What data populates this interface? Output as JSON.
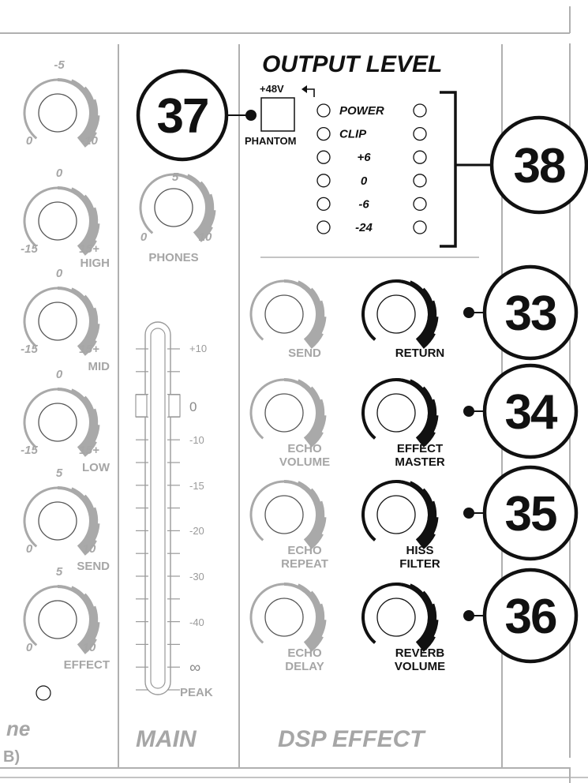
{
  "colors": {
    "ink": "#111111",
    "inactive": "#a9a9a9",
    "panel_line": "#b0b0b0",
    "background": "#ffffff"
  },
  "sections": {
    "main_title": "MAIN",
    "dsp_title": "DSP EFFECT",
    "output_level_title": "OUTPUT LEVEL",
    "left_partial_line1": "ne",
    "left_partial_line2": "B)"
  },
  "left_knobs": [
    {
      "top": "-5",
      "left": "0",
      "right": "-10",
      "label": ""
    },
    {
      "top": "0",
      "left": "-15",
      "right": "15+",
      "label": "HIGH"
    },
    {
      "top": "0",
      "left": "-15",
      "right": "15+",
      "label": "MID"
    },
    {
      "top": "0",
      "left": "-15",
      "right": "15+",
      "label": "LOW"
    },
    {
      "top": "5",
      "left": "0",
      "right": "10",
      "label": "SEND"
    },
    {
      "top": "5",
      "left": "0",
      "right": "10",
      "label": "EFFECT"
    }
  ],
  "phones_knob": {
    "top": "5",
    "left": "0",
    "right": "10",
    "label": "PHONES"
  },
  "phantom": {
    "voltage_label": "+48V",
    "button_label": "PHANTOM"
  },
  "led_labels": [
    "POWER",
    "CLIP",
    "+6",
    "0",
    "-6",
    "-24"
  ],
  "meter": {
    "labels": [
      "+10",
      "0",
      "-10",
      "-15",
      "-20",
      "-30",
      "-40",
      "∞"
    ],
    "peak_label": "PEAK"
  },
  "dsp_knobs_left": [
    {
      "line1": "SEND",
      "line2": ""
    },
    {
      "line1": "ECHO",
      "line2": "VOLUME"
    },
    {
      "line1": "ECHO",
      "line2": "REPEAT"
    },
    {
      "line1": "ECHO",
      "line2": "DELAY"
    }
  ],
  "dsp_knobs_right": [
    {
      "line1": "RETURN",
      "line2": "",
      "callout": "33"
    },
    {
      "line1": "EFFECT",
      "line2": "MASTER",
      "callout": "34"
    },
    {
      "line1": "HISS",
      "line2": "FILTER",
      "callout": "35"
    },
    {
      "line1": "REVERB",
      "line2": "VOLUME",
      "callout": "36"
    }
  ],
  "callouts": {
    "phantom": "37",
    "output_level": "38"
  }
}
